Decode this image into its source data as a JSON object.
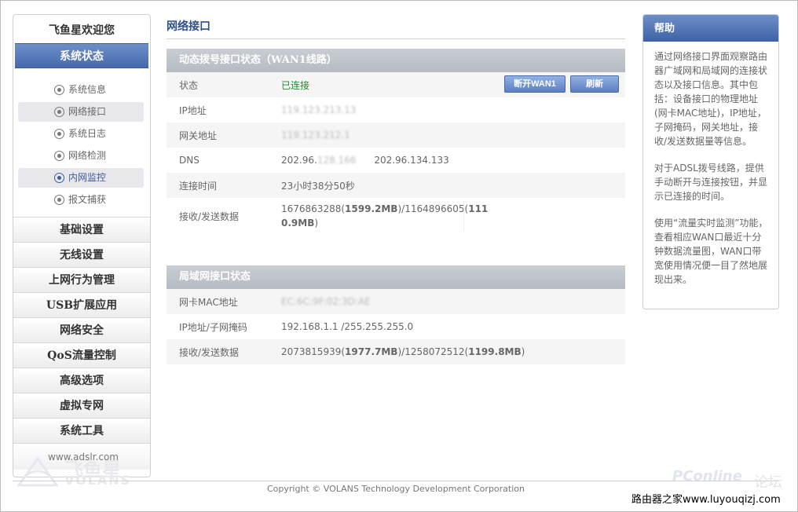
{
  "sidebar": {
    "welcome": "飞鱼星欢迎您",
    "active_group": "系统状态",
    "sub_items": [
      {
        "label": "系统信息"
      },
      {
        "label": "网络接口"
      },
      {
        "label": "系统日志"
      },
      {
        "label": "网络检测"
      },
      {
        "label": "内网监控"
      },
      {
        "label": "报文捕获"
      }
    ],
    "menu": [
      {
        "label": "基础设置"
      },
      {
        "label": "无线设置"
      },
      {
        "label": "上网行为管理"
      },
      {
        "label": "USB扩展应用"
      },
      {
        "label": "网络安全"
      },
      {
        "label": "QoS流量控制"
      },
      {
        "label": "高级选项"
      },
      {
        "label": "虚拟专网"
      },
      {
        "label": "系统工具"
      }
    ],
    "footer_url": "www.adslr.com"
  },
  "main": {
    "title": "网络接口",
    "wan": {
      "heading": "动态拨号接口状态（WAN1线路）",
      "status_label": "状态",
      "status_value": "已连接",
      "disconnect_btn": "断开WAN1",
      "refresh_btn": "刷新",
      "ip_label": "IP地址",
      "ip_value": "119.123.213.13",
      "gateway_label": "网关地址",
      "gateway_value": "119.123.212.1",
      "dns_label": "DNS",
      "dns1_a": "202.96.",
      "dns1_b": "128.166",
      "dns2_a": "202.",
      "dns2_b": "96.134.133",
      "conn_time_label": "连接时间",
      "conn_time_value": "23小时38分50秒",
      "traffic_label": "接收/发送数据",
      "rx_bytes": "1676863288",
      "rx_mb": "1599.2MB",
      "tx_bytes": "1164896605",
      "tx_mb_a": "111",
      "tx_mb_b": "0.9MB"
    },
    "lan": {
      "heading": "局域网接口状态",
      "mac_label": "网卡MAC地址",
      "mac_value": "EC:6C:9F:02:3D:AE",
      "ip_mask_label": "IP地址/子网掩码",
      "ip_mask_value": "192.168.1.1 /255.255.255.0",
      "traffic_label": "接收/发送数据",
      "rx_bytes": "2073815939",
      "rx_mb": "1977.7MB",
      "tx_bytes": "1258072512",
      "tx_mb": "1199.8MB"
    }
  },
  "help": {
    "title": "帮助",
    "p1": "通过网络接口界面观察路由器广域网和局域网的连接状态以及接口信息。其中包括：设备接口的物理地址(网卡MAC地址)，IP地址，子网掩码，网关地址，接收/发送数据量等信息。",
    "p2": "对于ADSL拨号线路，提供手动断开与连接按钮，并显示已连接的时间。",
    "p3": "使用“流量实时监测”功能，查看相应WAN口最近十分钟数据流量图，WAN口带宽使用情况便一目了然地展现出来。"
  },
  "footer": {
    "copyright": "Copyright © VOLANS Technology Development Corporation"
  },
  "watermarks": {
    "logo_cn": "飞鱼星",
    "logo_en": "VOLANS",
    "pconline": "PConline",
    "luntan": "论坛",
    "site": "路由器之家www.luyouqizj.com"
  }
}
